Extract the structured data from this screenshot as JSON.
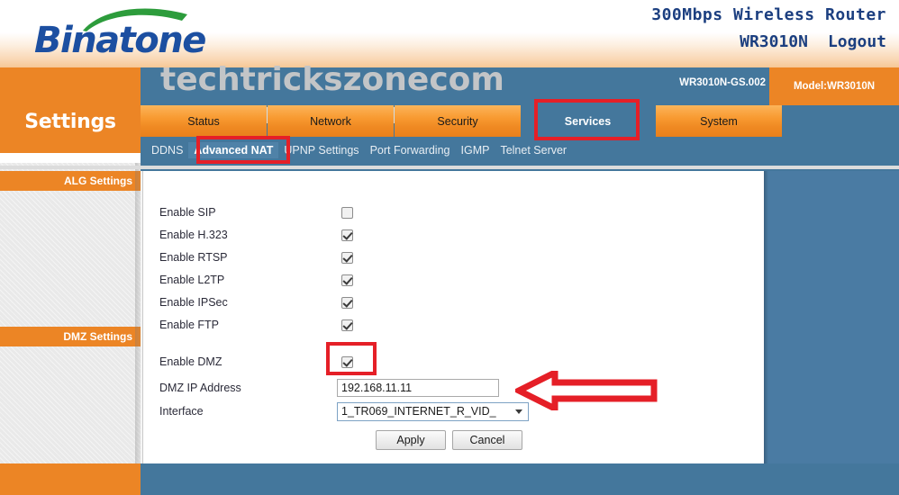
{
  "header": {
    "logo_text": "Binatone",
    "product_line1": "300Mbps Wireless Router",
    "model_line": "WR3010N",
    "logout_label": "Logout"
  },
  "banner": {
    "watermark": "techtrickszonecom",
    "firmware_version": "WR3010N-GS.002",
    "model_label": "Model:WR3010N"
  },
  "settings_title": "Settings",
  "nav": {
    "tabs": [
      {
        "label": "Status",
        "active": false
      },
      {
        "label": "Network",
        "active": false
      },
      {
        "label": "Security",
        "active": false
      },
      {
        "label": "Services",
        "active": true
      },
      {
        "label": "System",
        "active": false
      }
    ],
    "subtabs": [
      {
        "label": "DDNS",
        "active": false
      },
      {
        "label": "Advanced NAT",
        "active": true
      },
      {
        "label": "UPNP Settings",
        "active": false
      },
      {
        "label": "Port Forwarding",
        "active": false
      },
      {
        "label": "IGMP",
        "active": false
      },
      {
        "label": "Telnet Server",
        "active": false
      }
    ]
  },
  "sidebar": {
    "sections": [
      {
        "label": "ALG Settings"
      },
      {
        "label": "DMZ Settings"
      }
    ]
  },
  "alg": {
    "rows": [
      {
        "label": "Enable SIP",
        "checked": false
      },
      {
        "label": "Enable H.323",
        "checked": true
      },
      {
        "label": "Enable RTSP",
        "checked": true
      },
      {
        "label": "Enable L2TP",
        "checked": true
      },
      {
        "label": "Enable IPSec",
        "checked": true
      },
      {
        "label": "Enable FTP",
        "checked": true
      }
    ]
  },
  "dmz": {
    "enable_label": "Enable DMZ",
    "enable_checked": true,
    "ip_label": "DMZ IP Address",
    "ip_value": "192.168.11.11",
    "ip_placeholder": "",
    "interface_label": "Interface",
    "interface_value": "1_TR069_INTERNET_R_VID_"
  },
  "buttons": {
    "apply_label": "Apply",
    "cancel_label": "Cancel"
  },
  "annotations": {
    "highlight_color": "#e51f27",
    "arrow_direction": "left",
    "highlighted": [
      "Services",
      "Advanced NAT",
      "Enable DMZ checkbox"
    ]
  },
  "colors": {
    "orange": "#ec8525",
    "blue": "#44779c",
    "logo_blue": "#1c4fa1",
    "logo_green": "#2d9c3c",
    "annotation_red": "#e51f27"
  }
}
